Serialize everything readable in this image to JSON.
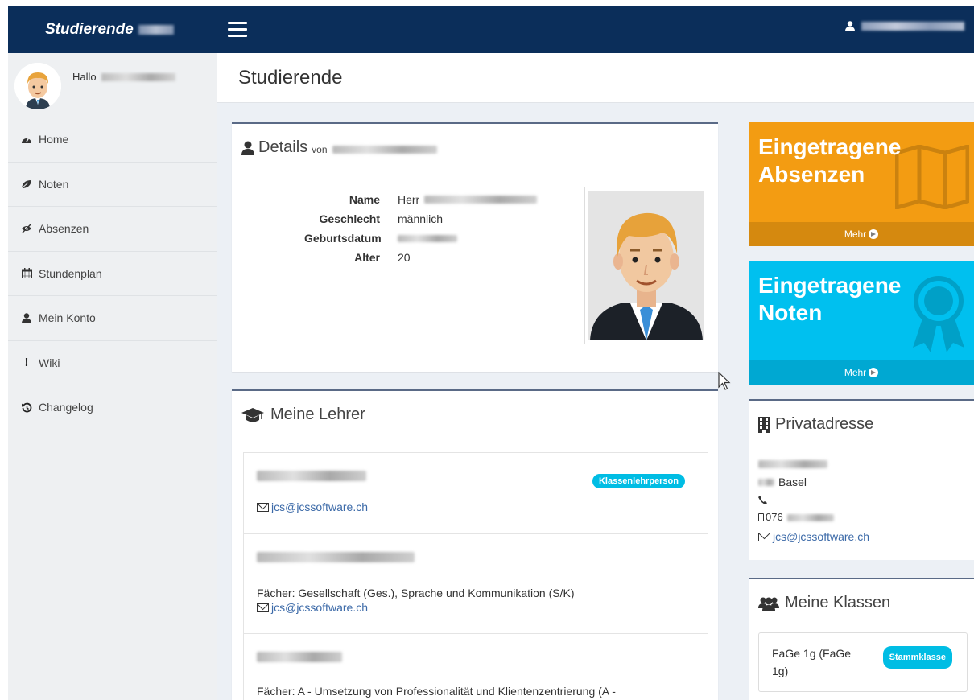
{
  "topbar": {
    "brand": "Studierende"
  },
  "sidebar": {
    "hello": "Hallo",
    "items": [
      {
        "label": "Home",
        "icon": "dashboard-icon"
      },
      {
        "label": "Noten",
        "icon": "leaf-icon"
      },
      {
        "label": "Absenzen",
        "icon": "eye-slash-icon"
      },
      {
        "label": "Stundenplan",
        "icon": "calendar-icon"
      },
      {
        "label": "Mein Konto",
        "icon": "user-icon"
      },
      {
        "label": "Wiki",
        "icon": "exclamation-icon"
      },
      {
        "label": "Changelog",
        "icon": "history-icon"
      }
    ]
  },
  "page": {
    "title": "Studierende"
  },
  "details": {
    "title": "Details",
    "von": "von",
    "rows": [
      {
        "key": "Name",
        "value": "Herr"
      },
      {
        "key": "Geschlecht",
        "value": "männlich"
      },
      {
        "key": "Geburtsdatum",
        "value": ""
      },
      {
        "key": "Alter",
        "value": "20"
      }
    ]
  },
  "lehrer": {
    "title": "Meine Lehrer",
    "items": [
      {
        "badge": "Klassenlehrperson",
        "faecher": "",
        "email": "jcs@jcssoftware.ch"
      },
      {
        "badge": "",
        "faecher": "Fächer: Gesellschaft (Ges.), Sprache und Kommunikation (S/K)",
        "email": "jcs@jcssoftware.ch"
      },
      {
        "badge": "",
        "faecher": "Fächer: A - Umsetzung von Professionalität und Klientenzentrierung (A -",
        "email": ""
      }
    ]
  },
  "tiles": {
    "absenzen": {
      "title_line1": "Eingetragene",
      "title_line2": "Absenzen",
      "more": "Mehr",
      "color": "#f39c12"
    },
    "noten": {
      "title_line1": "Eingetragene",
      "title_line2": "Noten",
      "more": "Mehr",
      "color": "#00c0ef"
    }
  },
  "privatadresse": {
    "title": "Privatadresse",
    "city": "Basel",
    "phone_prefix": "076",
    "email": "jcs@jcssoftware.ch"
  },
  "klassen": {
    "title": "Meine Klassen",
    "class_line1": "FaGe 1g (FaGe",
    "class_line2": "1g)",
    "badge": "Stammklasse"
  }
}
